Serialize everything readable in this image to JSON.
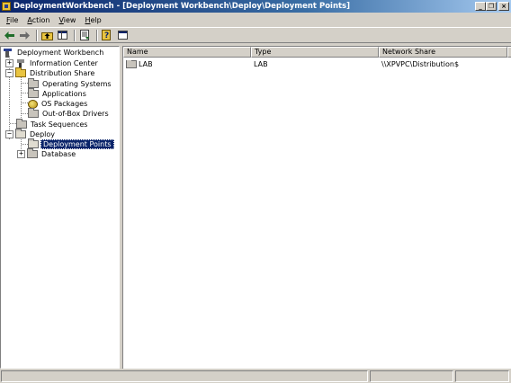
{
  "window": {
    "title": "DeploymentWorkbench - [Deployment Workbench\\Deploy\\Deployment Points]",
    "caption_buttons": {
      "minimize": "_",
      "restore": "❐",
      "close": "×"
    }
  },
  "menu": [
    {
      "key": "F",
      "rest": "ile"
    },
    {
      "key": "A",
      "rest": "ction"
    },
    {
      "key": "V",
      "rest": "iew"
    },
    {
      "key": "H",
      "rest": "elp"
    }
  ],
  "toolbar": {
    "icons": [
      "back-arrow-icon",
      "forward-arrow-icon",
      "up-folder-icon",
      "show-hide-tree-icon",
      "export-list-icon",
      "help-icon",
      "properties-icon"
    ]
  },
  "tree": {
    "root": "Deployment Workbench",
    "items": [
      {
        "label": "Information Center",
        "icon": "info-icon",
        "expander": "+"
      },
      {
        "label": "Distribution Share",
        "icon": "gold-folder-icon",
        "expander": "−"
      },
      {
        "label": "Operating Systems",
        "icon": "folder-icon"
      },
      {
        "label": "Applications",
        "icon": "folder-icon"
      },
      {
        "label": "OS Packages",
        "icon": "package-icon"
      },
      {
        "label": "Out-of-Box Drivers",
        "icon": "folder-icon"
      },
      {
        "label": "Task Sequences",
        "icon": "folder-icon"
      },
      {
        "label": "Deploy",
        "icon": "folder-icon",
        "expander": "−"
      },
      {
        "label": "Deployment Points",
        "icon": "folder-icon",
        "selected": true
      },
      {
        "label": "Database",
        "icon": "folder-icon",
        "expander": "+"
      }
    ]
  },
  "list": {
    "columns": [
      "Name",
      "Type",
      "Network Share"
    ],
    "rows": [
      {
        "name": "LAB",
        "type": "LAB",
        "network_share": "\\\\XPVPC\\Distribution$"
      }
    ]
  },
  "statusbar": {
    "segments": [
      "",
      "",
      "",
      ""
    ]
  },
  "colors": {
    "titlebar": "#0a246a",
    "selection": "#0a246a",
    "face": "#d4d0c8"
  }
}
